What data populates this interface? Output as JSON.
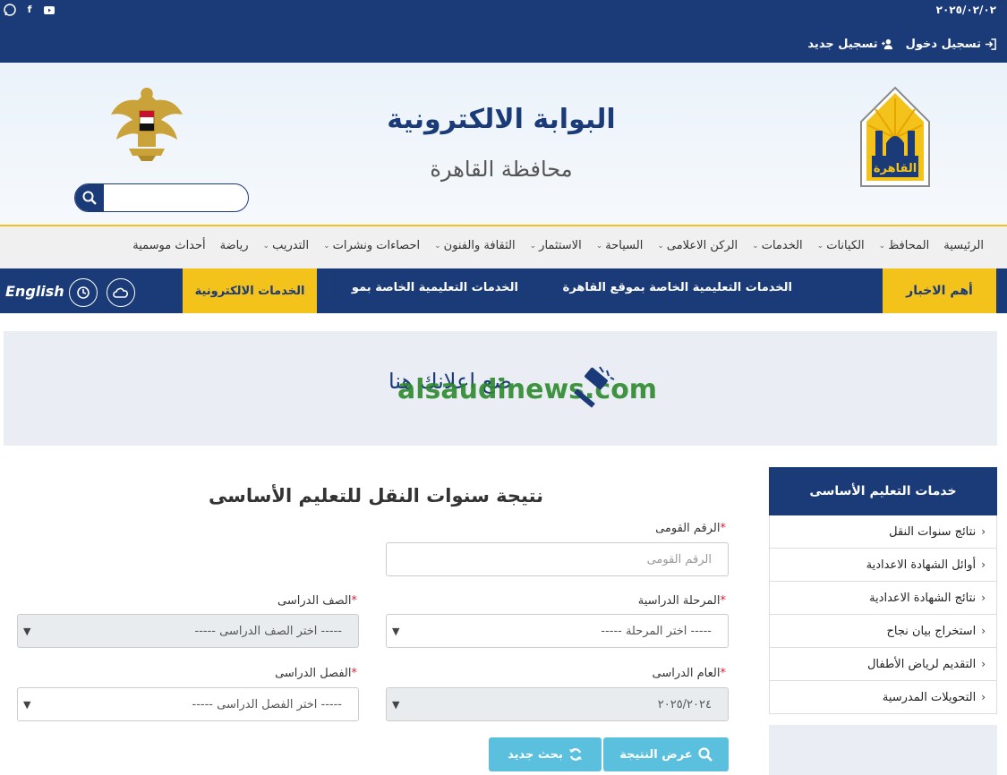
{
  "topbar": {
    "date": "٢٠٢٥/٠٢/٠٢",
    "social_icons": [
      "whatsapp-icon",
      "facebook-icon",
      "youtube-icon"
    ],
    "login_label": "تسجيل دخول",
    "register_label": "تسجيل جديد"
  },
  "header": {
    "title": "البوابة الالكترونية",
    "subtitle": "محافظة القاهرة",
    "search_placeholder": ""
  },
  "nav": {
    "items": [
      {
        "label": "الرئيسية",
        "dropdown": false
      },
      {
        "label": "المحافظ",
        "dropdown": true
      },
      {
        "label": "الكيانات",
        "dropdown": true
      },
      {
        "label": "الخدمات",
        "dropdown": true
      },
      {
        "label": "الركن الاعلامى",
        "dropdown": true
      },
      {
        "label": "السياحة",
        "dropdown": true
      },
      {
        "label": "الاستثمار",
        "dropdown": true
      },
      {
        "label": "الثقافة والفنون",
        "dropdown": true
      },
      {
        "label": "احصاءات ونشرات",
        "dropdown": true
      },
      {
        "label": "التدريب",
        "dropdown": true
      },
      {
        "label": "رياضة",
        "dropdown": false
      },
      {
        "label": "أحداث موسمية",
        "dropdown": false
      }
    ]
  },
  "newsbar": {
    "label": "أهم الاخبار",
    "headline_1": "الخدمات التعليمية الخاصة بموقع القاهرة",
    "headline_2": "الخدمات التعليمية الخاصة بمو",
    "eservices_label": "الخدمات الالكترونية",
    "english_label": "English"
  },
  "banner": {
    "message": "ضع اعلانك هنا",
    "watermark": "alsaudinews.com"
  },
  "sidebar": {
    "title": "خدمات التعليم الأساسى",
    "items": [
      "نتائج سنوات النقل",
      "أوائل الشهادة الاعدادية",
      "نتائج الشهادة الاعدادية",
      "استخراج بيان نجاح",
      "التقديم لرياض الأطفال",
      "التحويلات المدرسية"
    ]
  },
  "form": {
    "title": "نتيجة سنوات النقل للتعليم الأساسى",
    "national_id_label": "الرقم القومى",
    "national_id_placeholder": "الرقم القومى",
    "stage_label": "المرحلة الدراسية",
    "stage_value": "----- اختر المرحلة -----",
    "grade_label": "الصف الدراسى",
    "grade_value": "----- اختر الصف الدراسى -----",
    "year_label": "العام الدراسى",
    "year_value": "٢٠٢٥/٢٠٢٤",
    "term_label": "الفصل الدراسى",
    "term_value": "----- اختر الفصل الدراسى -----",
    "required_mark": "*",
    "show_result_label": "عرض النتيجة",
    "new_search_label": "بحث جديد"
  },
  "colors": {
    "primary": "#1a3a78",
    "accent": "#f3c21b",
    "button": "#5bc0de"
  }
}
